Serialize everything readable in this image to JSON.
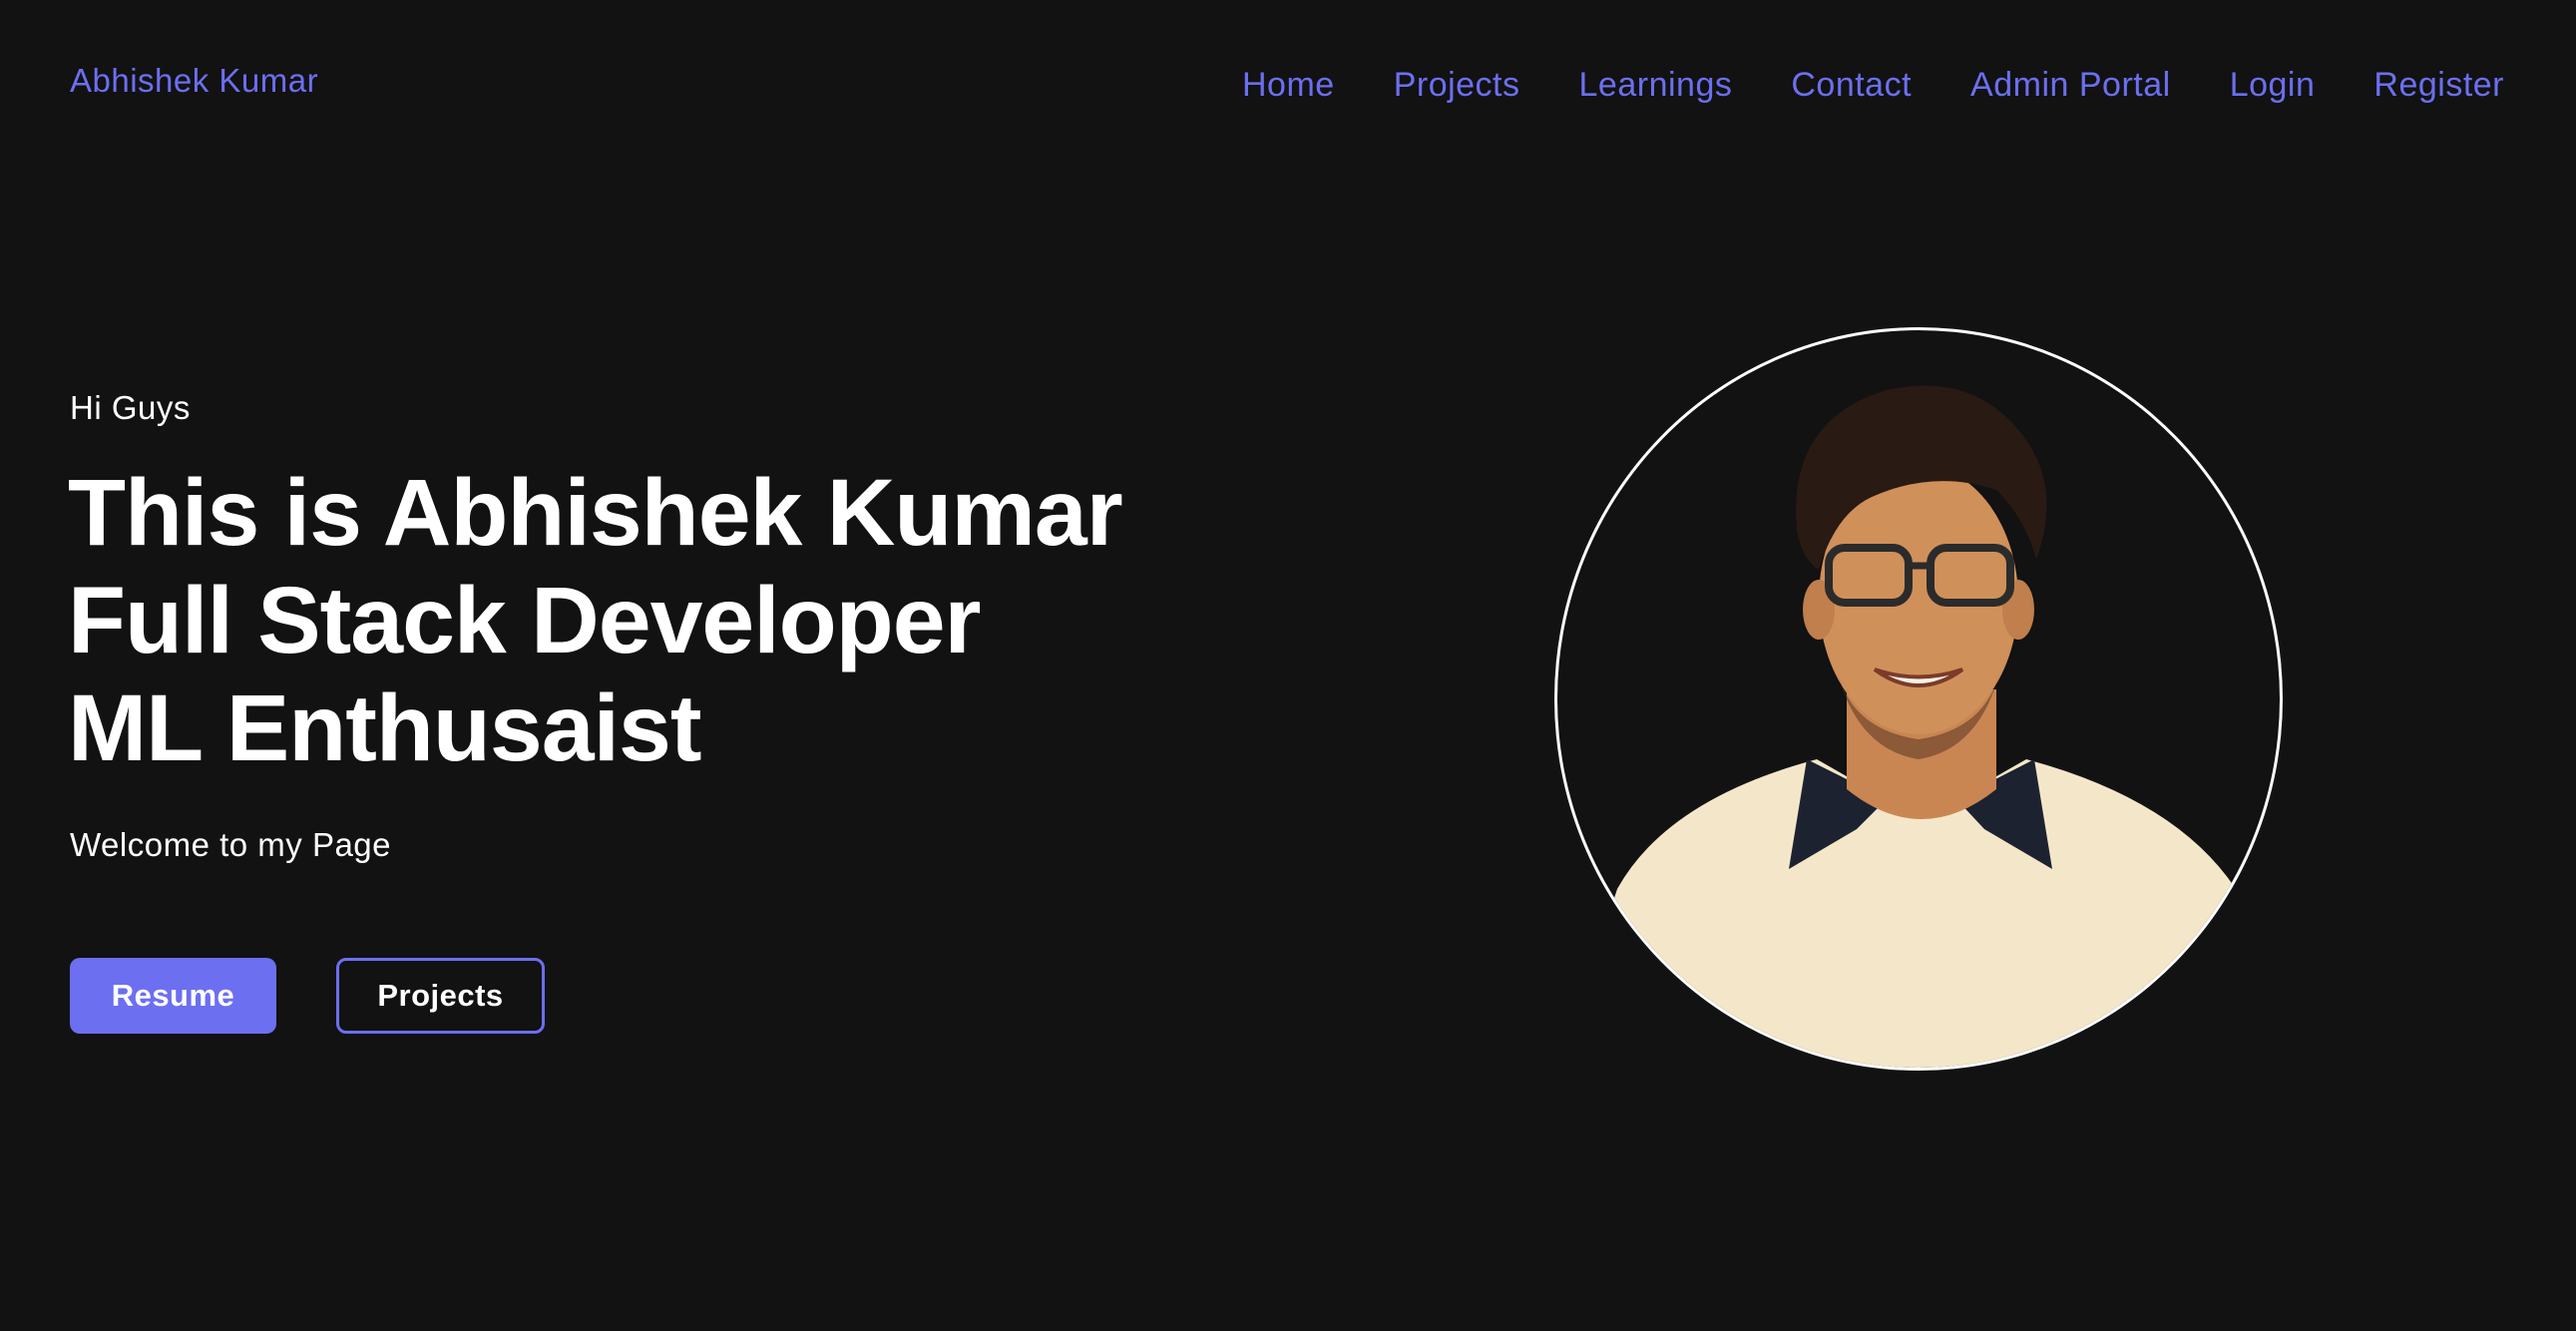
{
  "header": {
    "brand": "Abhishek Kumar",
    "nav": [
      {
        "label": "Home"
      },
      {
        "label": "Projects"
      },
      {
        "label": "Learnings"
      },
      {
        "label": "Contact"
      },
      {
        "label": "Admin Portal"
      },
      {
        "label": "Login"
      },
      {
        "label": "Register"
      }
    ]
  },
  "hero": {
    "greeting": "Hi Guys",
    "headline": [
      "This is Abhishek Kumar",
      "Full Stack Developer",
      "ML Enthusaist"
    ],
    "welcome": "Welcome to my Page",
    "resume_label": "Resume",
    "projects_label": "Projects"
  },
  "colors": {
    "background": "#121212",
    "accent": "#6c6ff0",
    "text": "#ffffff"
  },
  "icons": {
    "portrait": "profile-photo"
  }
}
